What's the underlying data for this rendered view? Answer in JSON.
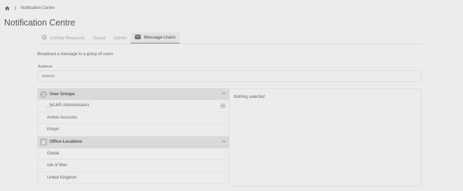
{
  "breadcrumb": {
    "current": "Notification Centre"
  },
  "page": {
    "title": "Notification Centre"
  },
  "tabs": [
    {
      "label": "Activity Requests",
      "icon": "user-group-icon"
    },
    {
      "label": "Social"
    },
    {
      "label": "Admin"
    },
    {
      "label": "Message Users",
      "icon": "envelope-icon",
      "active": true
    }
  ],
  "form": {
    "intro": "Broadcast a message to a group of users",
    "audience_label": "Audience",
    "search_placeholder": "Search"
  },
  "groups": [
    {
      "title": "User Groups",
      "icon": "users-icon",
      "items": [
        "_fyiLMS Administrators",
        "Amber Accounts",
        "Khepri"
      ]
    },
    {
      "title": "Office Locations",
      "icon": "building-icon",
      "items": [
        "Global",
        "Isle of Man",
        "United Kingdom"
      ]
    }
  ],
  "selection": {
    "empty_text": "Nothing selected"
  }
}
